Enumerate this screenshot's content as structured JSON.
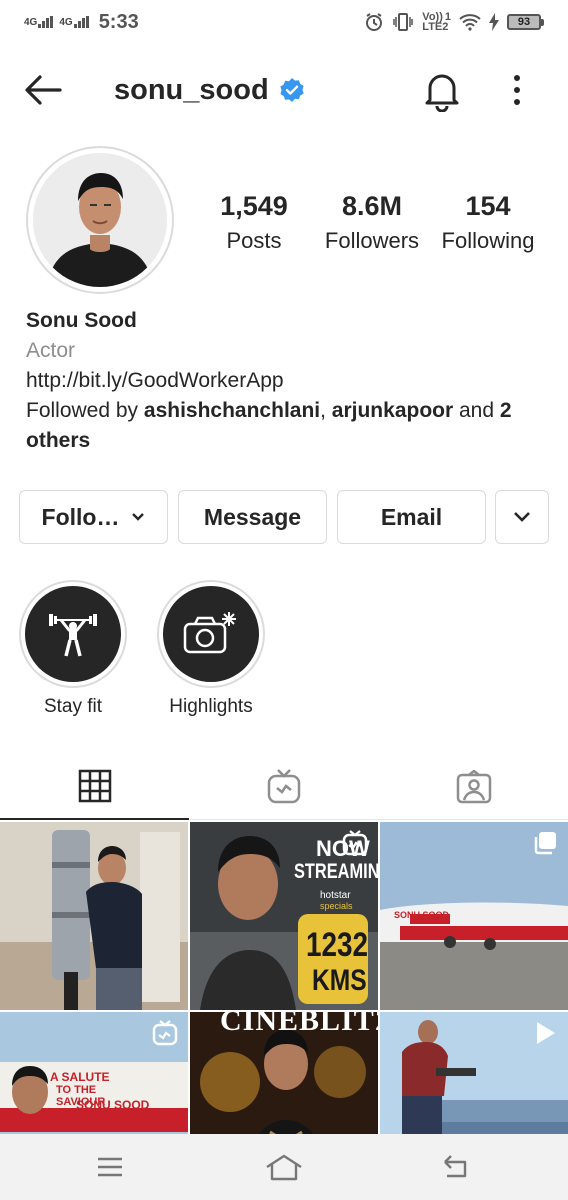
{
  "status_bar": {
    "network_1": "4G",
    "network_2": "4G",
    "time": "5:33",
    "volte": "Vo))",
    "lte_1": "1",
    "lte_label": "LTE2",
    "battery": "93"
  },
  "header": {
    "username": "sonu_sood"
  },
  "stats": {
    "posts_count": "1,549",
    "posts_label": "Posts",
    "followers_count": "8.6M",
    "followers_label": "Followers",
    "following_count": "154",
    "following_label": "Following"
  },
  "bio": {
    "full_name": "Sonu Sood",
    "category": "Actor",
    "link": "http://bit.ly/GoodWorkerApp",
    "followed_by_prefix": "Followed by ",
    "followed_by_user1": "ashishchanchlani",
    "followed_by_sep": ", ",
    "followed_by_user2": "arjunkapoor",
    "followed_by_and": " and ",
    "followed_by_others": "2 others"
  },
  "actions": {
    "follow_label": "Follo…",
    "message_label": "Message",
    "email_label": "Email"
  },
  "highlights": [
    {
      "label": "Stay fit",
      "icon": "weightlifter-icon"
    },
    {
      "label": "Highlights",
      "icon": "camera-icon"
    }
  ],
  "tabs": [
    {
      "icon": "grid-icon",
      "active": true
    },
    {
      "icon": "igtv-icon",
      "active": false
    },
    {
      "icon": "tagged-icon",
      "active": false
    }
  ],
  "posts": {
    "post2_line1": "NOW",
    "post2_line2": "STREAMING",
    "post2_brand": "hotstar",
    "post2_sub": "specials",
    "post2_num": "1232",
    "post2_unit": "KMS",
    "post3_text": "SONU SOOD",
    "post4_line1": "A SALUTE",
    "post4_line2": "TO THE",
    "post4_line3": "SAVIOUR",
    "post4_line4": "SONU SOOD",
    "post5_mast": "CINEBLITZ"
  },
  "colors": {
    "verified_blue": "#3897f0",
    "text_primary": "#262626",
    "text_secondary": "#8e8e8e",
    "border": "#dbdbdb"
  }
}
